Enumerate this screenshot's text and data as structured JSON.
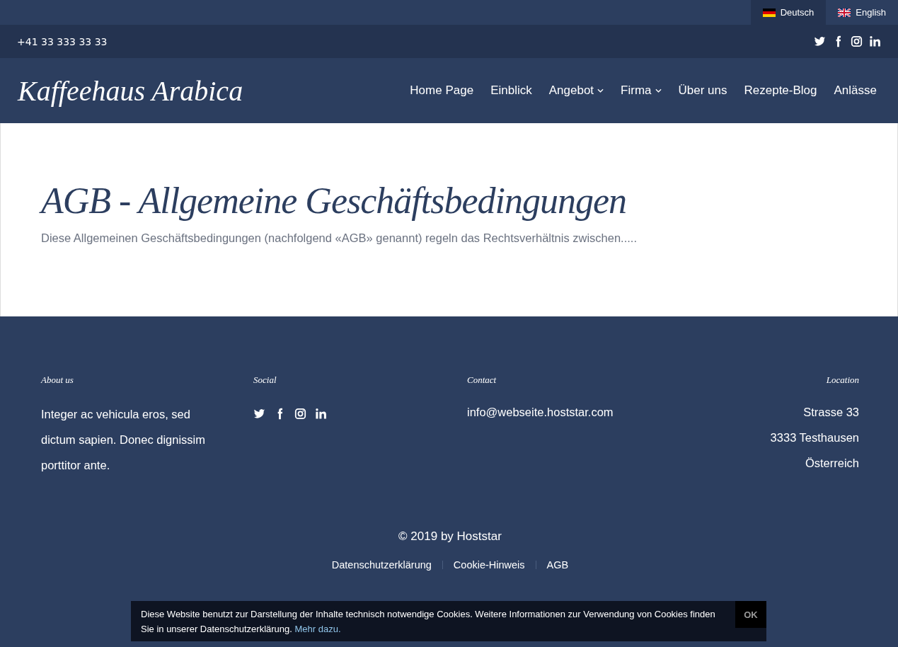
{
  "languages": [
    {
      "label": "Deutsch",
      "kind": "de",
      "selected": true
    },
    {
      "label": "English",
      "kind": "gb",
      "selected": false
    }
  ],
  "top_bar": {
    "phone": "+41 33 333 33 33",
    "social": [
      {
        "kind": "twitter"
      },
      {
        "kind": "facebook"
      },
      {
        "kind": "instagram"
      },
      {
        "kind": "linkedin"
      }
    ]
  },
  "header": {
    "logo": "Kaffeehaus Arabica",
    "nav": [
      {
        "label": "Home Page",
        "dropdown": false
      },
      {
        "label": "Einblick",
        "dropdown": false
      },
      {
        "label": "Angebot",
        "dropdown": true
      },
      {
        "label": "Firma",
        "dropdown": true
      },
      {
        "label": "Über uns",
        "dropdown": false
      },
      {
        "label": "Rezepte-Blog",
        "dropdown": false
      },
      {
        "label": "Anlässe",
        "dropdown": false
      }
    ]
  },
  "content": {
    "title": "AGB - Allgemeine Geschäftsbedingungen",
    "intro": "Diese Allgemeinen Geschäftsbedingungen (nachfolgend «AGB» genannt) regeln das Rechtsverhältnis zwischen....."
  },
  "footer": {
    "columns": [
      {
        "heading": "About us",
        "kind": "text",
        "text": "Integer ac vehicula eros, sed dictum sapien. Donec dignissim porttitor ante."
      },
      {
        "heading": "Social",
        "kind": "social",
        "icons": [
          {
            "kind": "twitter"
          },
          {
            "kind": "facebook"
          },
          {
            "kind": "instagram"
          },
          {
            "kind": "linkedin"
          }
        ]
      },
      {
        "heading": "Contact",
        "kind": "lines",
        "lines": [
          "info@webseite.hoststar.com"
        ]
      },
      {
        "heading": "Location",
        "kind": "lines",
        "lines": [
          "Strasse 33",
          "3333 Testhausen",
          "Österreich"
        ]
      }
    ],
    "copyright": "© 2019 by Hoststar",
    "links": [
      "Datenschutzerklärung",
      "Cookie-Hinweis",
      "AGB"
    ]
  },
  "cookie_banner": {
    "text": "Diese Website benutzt zur Darstellung der Inhalte technisch notwendige Cookies. Weitere Informationen zur Verwendung von Cookies finden Sie in unserer Datenschutzerklärung.",
    "link": "Mehr dazu.",
    "button": "OK"
  }
}
